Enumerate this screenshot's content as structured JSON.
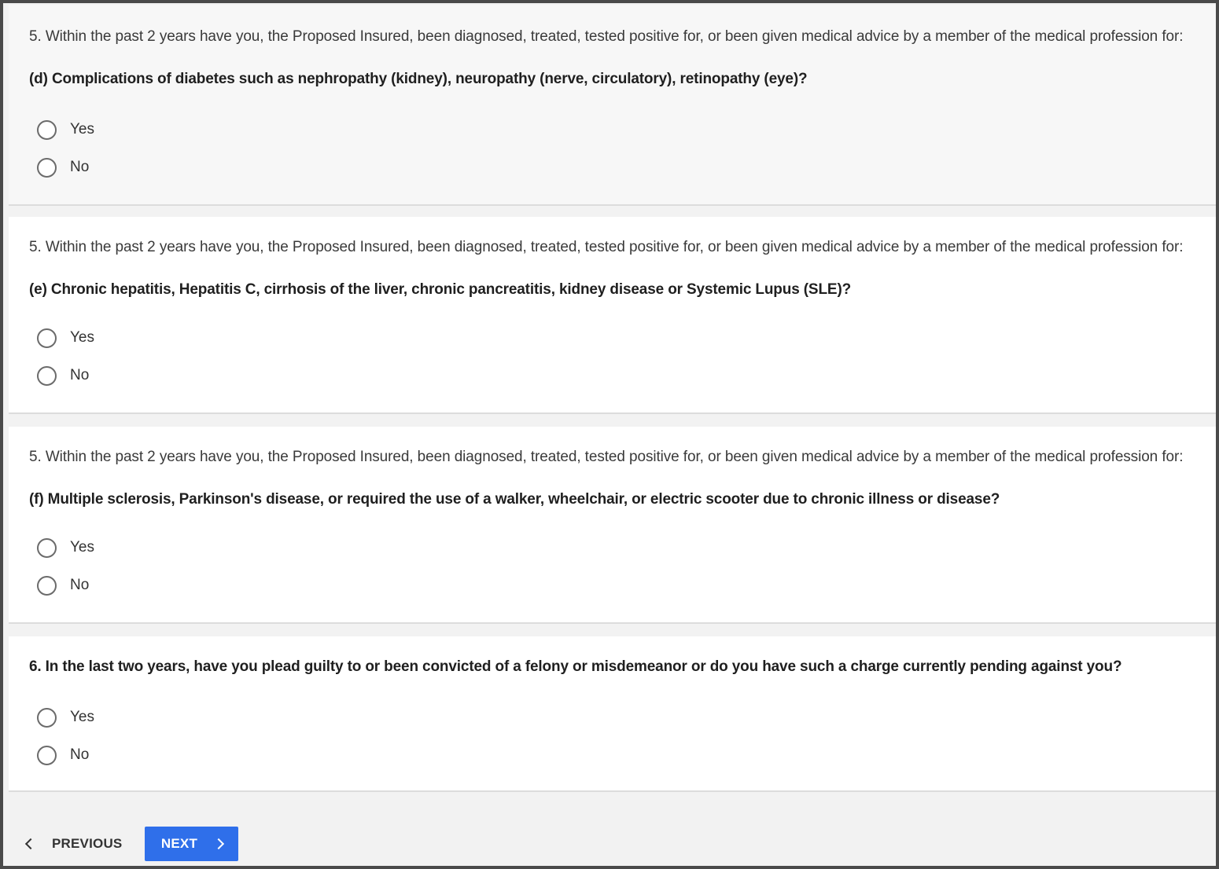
{
  "questions": [
    {
      "intro": "5. Within the past 2 years have you, the Proposed Insured, been diagnosed, treated, tested positive for, or been given medical advice by a member of the medical profession for:",
      "question": "(d) Complications of diabetes such as nephropathy (kidney), neuropathy (nerve, circulatory), retinopathy (eye)?",
      "options": [
        "Yes",
        "No"
      ]
    },
    {
      "intro": "5. Within the past 2 years have you, the Proposed Insured, been diagnosed, treated, tested positive for, or been given medical advice by a member of the medical profession for:",
      "question": "(e) Chronic hepatitis, Hepatitis C, cirrhosis of the liver, chronic pancreatitis, kidney disease or Systemic Lupus (SLE)?",
      "options": [
        "Yes",
        "No"
      ]
    },
    {
      "intro": "5. Within the past 2 years have you, the Proposed Insured, been diagnosed, treated, tested positive for, or been given medical advice by a member of the medical profession for:",
      "question": "(f) Multiple sclerosis, Parkinson's disease, or required the use of a walker, wheelchair, or electric scooter due to chronic illness or disease?",
      "options": [
        "Yes",
        "No"
      ]
    },
    {
      "question": "6. In the last two years, have you plead guilty to or been convicted of a felony or misdemeanor or do you have such a charge currently pending against you?",
      "options": [
        "Yes",
        "No"
      ]
    }
  ],
  "nav": {
    "previous_label": "PREVIOUS",
    "next_label": "NEXT"
  },
  "colors": {
    "accent": "#2f6fea"
  }
}
